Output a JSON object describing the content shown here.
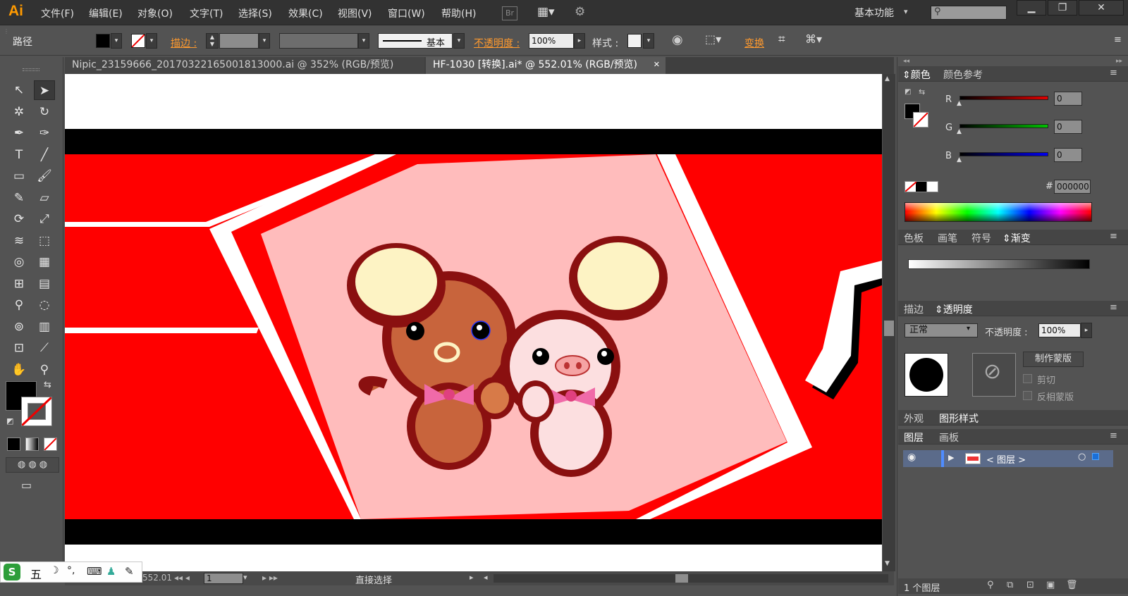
{
  "app": {
    "logo": "Ai"
  },
  "menu": [
    "文件(F)",
    "编辑(E)",
    "对象(O)",
    "文字(T)",
    "选择(S)",
    "效果(C)",
    "视图(V)",
    "窗口(W)",
    "帮助(H)"
  ],
  "menubar": {
    "br": "Br",
    "workspace": "基本功能",
    "workspace_caret": "▾",
    "search_placeholder": "",
    "minimize": "▁",
    "restore": "❐",
    "close": "✕"
  },
  "control": {
    "object_type": "路径",
    "stroke_label": "描边 :",
    "stroke_profile": "基本",
    "opacity_label": "不透明度 :",
    "opacity_value": "100%",
    "style_label": "样式 :",
    "transform_label": "变换"
  },
  "tabs": [
    {
      "label": "Nipic_23159666_20170322165001813000.ai @ 352% (RGB/预览)"
    },
    {
      "label": "HF-1030 [转换].ai* @ 552.01% (RGB/预览)"
    }
  ],
  "tab_close": "✕",
  "tools": [
    [
      "selection-tool",
      "↖"
    ],
    [
      "direct-selection-tool",
      "➤"
    ],
    [
      "magic-wand-tool",
      "✲"
    ],
    [
      "lasso-tool",
      "↻"
    ],
    [
      "pen-tool",
      "✒"
    ],
    [
      "curvature-tool",
      "✑"
    ],
    [
      "type-tool",
      "T"
    ],
    [
      "line-tool",
      "╱"
    ],
    [
      "rectangle-tool",
      "▭"
    ],
    [
      "paintbrush-tool",
      "🖌"
    ],
    [
      "pencil-tool",
      "✎"
    ],
    [
      "eraser-tool",
      "▱"
    ],
    [
      "rotate-tool",
      "⟳"
    ],
    [
      "scale-tool",
      "⤢"
    ],
    [
      "width-tool",
      "≋"
    ],
    [
      "free-transform-tool",
      "⬚"
    ],
    [
      "shape-builder-tool",
      "◎"
    ],
    [
      "perspective-grid-tool",
      "▦"
    ],
    [
      "mesh-tool",
      "⊞"
    ],
    [
      "gradient-tool",
      "▤"
    ],
    [
      "eyedropper-tool",
      "⚲"
    ],
    [
      "blend-tool",
      "◌"
    ],
    [
      "symbol-sprayer-tool",
      "⊚"
    ],
    [
      "column-graph-tool",
      "▥"
    ],
    [
      "artboard-tool",
      "⊡"
    ],
    [
      "slice-tool",
      "⟋"
    ],
    [
      "hand-tool",
      "✋"
    ],
    [
      "zoom-tool",
      "⚲"
    ]
  ],
  "status": {
    "zoom": "552.01",
    "page": "1",
    "tool_name": "直接选择"
  },
  "ime": {
    "label": "五"
  },
  "panels": {
    "color": {
      "tabs": [
        "颜色",
        "颜色参考"
      ],
      "channels": [
        {
          "label": "R",
          "value": "0",
          "color": "#e00000"
        },
        {
          "label": "G",
          "value": "0",
          "color": "#00c000"
        },
        {
          "label": "B",
          "value": "0",
          "color": "#0000ee"
        }
      ],
      "hex_label": "#",
      "hex_value": "000000"
    },
    "swatch_tabs": [
      "色板",
      "画笔",
      "符号",
      "渐变"
    ],
    "transparency": {
      "tabs": [
        "描边",
        "透明度"
      ],
      "blend_mode": "正常",
      "opacity_label": "不透明度 :",
      "opacity_value": "100%",
      "make_mask": "制作蒙版",
      "clip": "剪切",
      "invert_mask": "反相蒙版"
    },
    "appearance_tabs": [
      "外观",
      "图形样式"
    ],
    "layers": {
      "tabs": [
        "图层",
        "画板"
      ],
      "layer_name": "< 图层 >",
      "footer": "1 个图层"
    }
  },
  "colors": {
    "accent": "#ff9a00",
    "artwork_red": "#ff0000",
    "artwork_pink": "#ffbcbc"
  }
}
